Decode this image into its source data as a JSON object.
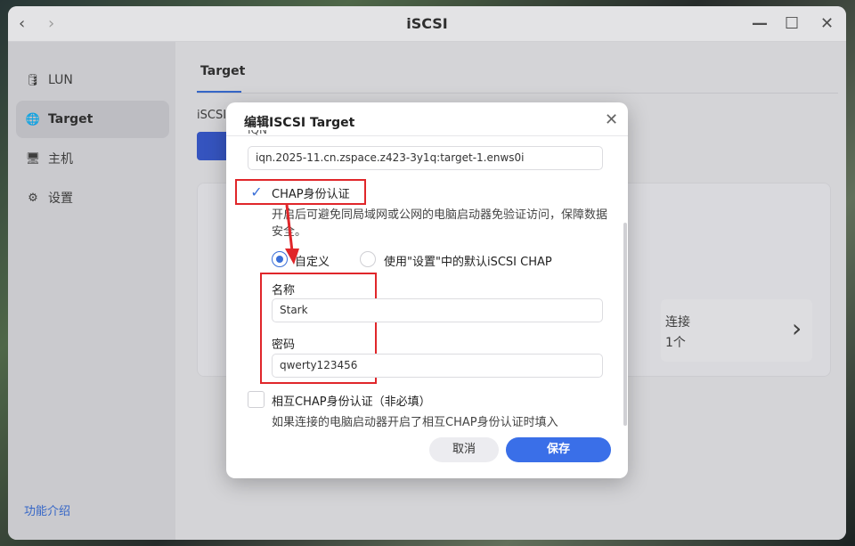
{
  "window": {
    "title": "iSCSI",
    "back_icon": "‹",
    "forward_icon": "›",
    "min_icon": "—",
    "max_icon": "☐",
    "close_icon": "✕"
  },
  "sidebar": {
    "items": [
      {
        "icon": "🛢",
        "label": "LUN"
      },
      {
        "icon": "🌐",
        "label": "Target"
      },
      {
        "icon": "🖥",
        "label": "主机"
      },
      {
        "icon": "⚙",
        "label": "设置"
      }
    ],
    "footer": "功能介绍"
  },
  "main": {
    "tab": "Target",
    "label": "iSCSI",
    "connections_label": "连接",
    "connections_count": "1个"
  },
  "dialog": {
    "title": "编辑ISCSI Target",
    "iqn_label": "IQN",
    "iqn_value": "iqn.2025-11.cn.zspace.z423-3y1q:target-1.enws0i",
    "chap_label": "CHAP身份认证",
    "chap_desc": "开启后可避免同局域网或公网的电脑启动器免验证访问，保障数据安全。",
    "radio_custom": "自定义",
    "radio_default": "使用\"设置\"中的默认iSCSI CHAP",
    "name_label": "名称",
    "name_value": "Stark",
    "password_label": "密码",
    "password_value": "qwerty123456",
    "mutual_label": "相互CHAP身份认证（非必填）",
    "mutual_desc": "如果连接的电脑启动器开启了相互CHAP身份认证时填入",
    "cancel": "取消",
    "save": "保存"
  },
  "colors": {
    "accent": "#3a6fe8",
    "highlight": "#e0262a"
  }
}
